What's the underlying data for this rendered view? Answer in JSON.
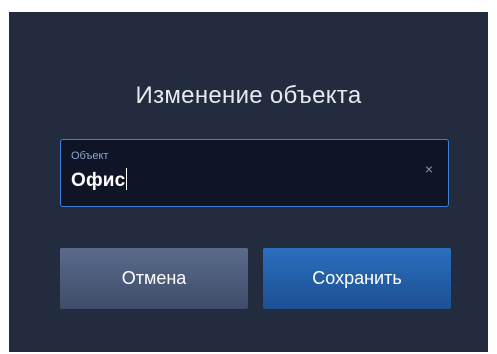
{
  "dialog": {
    "title": "Изменение объекта",
    "field": {
      "label": "Объект",
      "value": "Офис",
      "clear_glyph": "×"
    },
    "buttons": {
      "cancel_label": "Отмена",
      "save_label": "Сохранить"
    }
  },
  "colors": {
    "background": "#232b3e",
    "field_bg": "#0f1526",
    "field_border": "#3b82d6",
    "cancel_button": "#4c5a7a",
    "save_button": "#245fa8"
  },
  "icons": {
    "clear": "close-icon"
  }
}
